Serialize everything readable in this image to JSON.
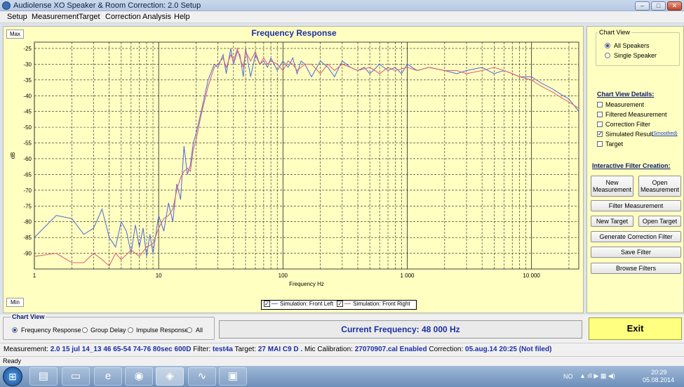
{
  "window": {
    "title": "Audiolense XO Speaker & Room Correction: 2.0 Setup",
    "controls": [
      "–",
      "□",
      "✕"
    ]
  },
  "menu": [
    "Setup",
    "Measurement",
    "Target",
    "Correction",
    "Analysis",
    "Help"
  ],
  "chart_panel": {
    "max_label": "Max",
    "min_label": "Min"
  },
  "legend": {
    "items": [
      {
        "label": "Simulation: Front Left",
        "checked": true,
        "color": "#5b73d8"
      },
      {
        "label": "Simulation: Front Right",
        "checked": true,
        "color": "#e0637a"
      }
    ]
  },
  "chart_data": {
    "type": "line",
    "title": "Frequency Response",
    "xlabel": "Frequency Hz",
    "ylabel": "dB",
    "xscale": "log",
    "xlim": [
      1,
      24000
    ],
    "ylim": [
      -95,
      -23
    ],
    "xticks": [
      "1",
      "10",
      "100",
      "1 000",
      "10 000"
    ],
    "yticks": [
      "-25",
      "-30",
      "-35",
      "-40",
      "-45",
      "-50",
      "-55",
      "-60",
      "-65",
      "-70",
      "-75",
      "-80",
      "-85",
      "-90"
    ],
    "grid": true,
    "series": [
      {
        "name": "Simulation: Front Left",
        "color": "#5b73d8",
        "x": [
          1,
          1.5,
          2,
          2.5,
          3,
          3.5,
          4,
          4.5,
          5,
          5.5,
          6,
          6.5,
          7,
          7.5,
          8,
          8.5,
          9,
          10,
          11,
          12,
          13,
          14,
          15,
          16,
          17,
          18,
          19,
          20,
          22,
          25,
          28,
          30,
          33,
          35,
          38,
          40,
          43,
          45,
          48,
          50,
          55,
          60,
          65,
          70,
          75,
          80,
          90,
          100,
          110,
          120,
          130,
          140,
          150,
          170,
          200,
          230,
          260,
          300,
          350,
          400,
          450,
          500,
          600,
          700,
          800,
          900,
          1000,
          1200,
          1500,
          2000,
          2500,
          3000,
          4000,
          5000,
          6000,
          7000,
          8000,
          10000,
          12000,
          15000,
          18000,
          20000,
          24000
        ],
        "y": [
          -85,
          -78,
          -79,
          -84,
          -82,
          -76,
          -85,
          -88,
          -80,
          -83,
          -90,
          -81,
          -88,
          -82,
          -91,
          -84,
          -90,
          -78,
          -83,
          -74,
          -80,
          -68,
          -73,
          -56,
          -65,
          -62,
          -55,
          -52,
          -45,
          -35,
          -30,
          -31,
          -27,
          -33,
          -25,
          -30,
          -26,
          -27,
          -34,
          -25,
          -34,
          -27,
          -30,
          -29,
          -31,
          -28,
          -32,
          -29,
          -31,
          -28,
          -33,
          -29,
          -30,
          -34,
          -29,
          -31,
          -34,
          -29,
          -31,
          -32,
          -31,
          -33,
          -30,
          -32,
          -31,
          -33,
          -30,
          -32,
          -31,
          -32,
          -33,
          -32,
          -31,
          -33,
          -32,
          -33,
          -34,
          -34,
          -36,
          -38,
          -40,
          -41,
          -45
        ]
      },
      {
        "name": "Simulation: Front Right",
        "color": "#e0637a",
        "x": [
          1,
          1.5,
          2,
          2.5,
          3,
          3.5,
          4,
          4.5,
          5,
          6,
          7,
          8,
          9,
          10,
          11,
          12,
          13,
          14,
          15,
          16,
          17,
          18,
          19,
          20,
          22,
          25,
          28,
          30,
          33,
          35,
          38,
          40,
          43,
          45,
          48,
          50,
          55,
          60,
          65,
          70,
          75,
          80,
          90,
          100,
          110,
          120,
          130,
          150,
          170,
          200,
          230,
          260,
          300,
          350,
          400,
          500,
          600,
          700,
          800,
          1000,
          1200,
          1500,
          2000,
          2500,
          3000,
          4000,
          5000,
          6000,
          7000,
          8000,
          10000,
          12000,
          15000,
          18000,
          20000,
          24000
        ],
        "y": [
          -91,
          -90,
          -93,
          -93,
          -90,
          -92,
          -94,
          -90,
          -92,
          -89,
          -91,
          -88,
          -87,
          -82,
          -79,
          -78,
          -76,
          -70,
          -66,
          -64,
          -63,
          -64,
          -57,
          -54,
          -46,
          -37,
          -31,
          -30,
          -28,
          -31,
          -27,
          -29,
          -25,
          -28,
          -31,
          -26,
          -29,
          -26,
          -30,
          -28,
          -30,
          -29,
          -30,
          -32,
          -29,
          -30,
          -32,
          -30,
          -30,
          -33,
          -30,
          -32,
          -30,
          -31,
          -32,
          -31,
          -33,
          -31,
          -32,
          -31,
          -32,
          -31,
          -32,
          -32,
          -33,
          -32,
          -31,
          -32,
          -33,
          -34,
          -35,
          -37,
          -39,
          -41,
          -42,
          -44
        ]
      }
    ]
  },
  "side": {
    "chart_view_group": "Chart View",
    "views": [
      {
        "label": "All Speakers",
        "selected": true
      },
      {
        "label": "Single Speaker",
        "selected": false
      }
    ],
    "details_header": "Chart View Details:",
    "details": [
      {
        "label": "Measurement",
        "checked": false
      },
      {
        "label": "Filtered Measurement",
        "checked": false
      },
      {
        "label": "Correction Filter",
        "checked": false
      },
      {
        "label": "Simulated Result",
        "checked": true
      },
      {
        "label": "Target",
        "checked": false
      }
    ],
    "smoothed": "(Smoothed)",
    "interactive_header": "Interactive Filter Creation:",
    "buttons": {
      "new_measurement": "New\nMeasurement",
      "open_measurement": "Open\nMeasurement",
      "filter_measurement": "Filter Measurement",
      "new_target": "New Target",
      "open_target": "Open Target",
      "generate": "Generate Correction Filter",
      "save": "Save Filter",
      "browse": "Browse Filters"
    }
  },
  "bottom": {
    "chart_view_label": "Chart View",
    "options": [
      {
        "label": "Frequency Response",
        "selected": true
      },
      {
        "label": "Group Delay",
        "selected": false
      },
      {
        "label": "Impulse Response",
        "selected": false
      },
      {
        "label": "All",
        "selected": false
      }
    ],
    "current_frequency": "Current Frequency: 48 000 Hz",
    "exit": "Exit"
  },
  "info": {
    "measurement_label": "Measurement:",
    "measurement": "2.0 15 jul 14_13 46 65-54 74-76 80sec 600D",
    "filter_label": "Filter:",
    "filter": "test4a",
    "target_label": "Target:",
    "target": "27 MAI C9 D .",
    "mic_label": "Mic Calibration:",
    "mic": "27070907.cal Enabled",
    "correction_label": "Correction:",
    "correction": "05.aug.14 20:25 (Not filed)"
  },
  "status": "Ready",
  "taskbar": {
    "lang": "NO",
    "time": "20:29",
    "date": "05.08.2014"
  }
}
